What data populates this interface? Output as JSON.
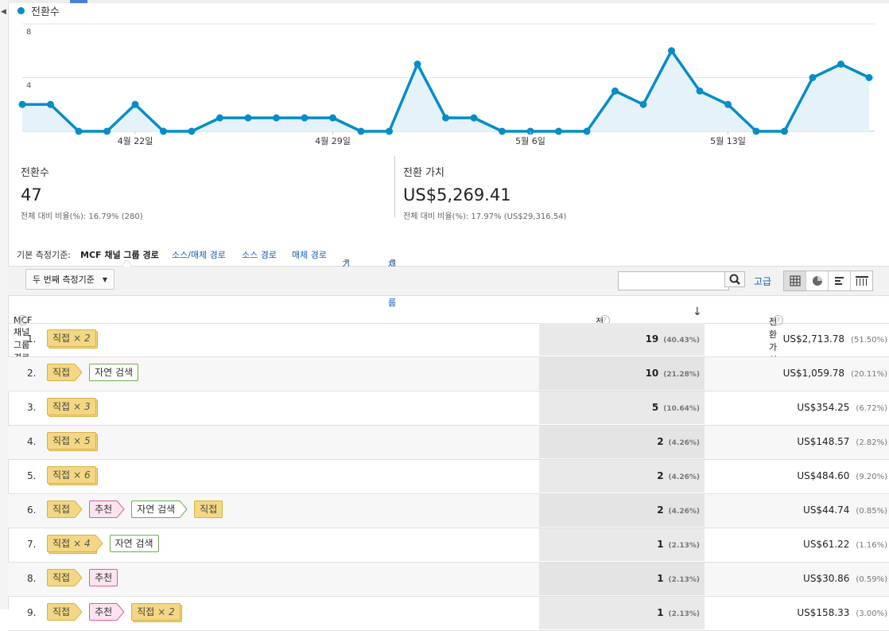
{
  "colors": {
    "accent": "#058dc7",
    "link": "#1a5fb4",
    "direct": "#f3d783",
    "organic": "#6ab04c",
    "referral": "#d9609a"
  },
  "legend": {
    "label": "전환수"
  },
  "chart_data": {
    "type": "area",
    "series": [
      {
        "name": "전환수",
        "values": [
          2,
          2,
          0,
          0,
          2,
          0,
          0,
          1,
          1,
          1,
          1,
          1,
          0,
          0,
          5,
          1,
          1,
          0,
          0,
          0,
          0,
          3,
          2,
          6,
          3,
          2,
          0,
          0,
          4,
          5,
          4
        ]
      }
    ],
    "yticks": [
      "8",
      "4"
    ],
    "ylim": [
      0,
      8
    ],
    "xticks": [
      {
        "label": "4월 22일",
        "index": 4
      },
      {
        "label": "4월 29일",
        "index": 11
      },
      {
        "label": "5월 6일",
        "index": 18
      },
      {
        "label": "5월 13일",
        "index": 25
      }
    ],
    "grid": true
  },
  "metrics": [
    {
      "label": "전환수",
      "value": "47",
      "sub": "전체 대비 비율(%): 16.79% (280)"
    },
    {
      "label": "전환 가치",
      "value": "US$5,269.41",
      "sub": "전체 대비 비율(%): 17.97% (US$29,316.54)"
    }
  ],
  "dimensions": {
    "label": "기본 측정기준:",
    "active": "MCF 채널 그룹 경로",
    "links": [
      "소스/매체 경로",
      "소스 경로",
      "매체 경로"
    ],
    "other": "기타",
    "channel": "채널 그룹"
  },
  "toolbar": {
    "secondary": "두 번째 측정기준",
    "search_value": "",
    "advanced": "고급",
    "view_icons": [
      "grid-view-icon",
      "pie-view-icon",
      "performance-view-icon",
      "pivot-view-icon"
    ]
  },
  "table": {
    "headers": {
      "path": "MCF 채널 그룹 경로",
      "conversions": "전환수",
      "value": "전환 가치"
    },
    "rows": [
      {
        "num": "1.",
        "path": [
          {
            "label": "직접",
            "type": "direct",
            "count": "× 2"
          }
        ],
        "conv": "19",
        "conv_pct": "(40.43%)",
        "value": "US$2,713.78",
        "value_pct": "(51.50%)"
      },
      {
        "num": "2.",
        "path": [
          {
            "label": "직접",
            "type": "direct"
          },
          {
            "label": "자연 검색",
            "type": "organic"
          }
        ],
        "conv": "10",
        "conv_pct": "(21.28%)",
        "value": "US$1,059.78",
        "value_pct": "(20.11%)"
      },
      {
        "num": "3.",
        "path": [
          {
            "label": "직접",
            "type": "direct",
            "count": "× 3"
          }
        ],
        "conv": "5",
        "conv_pct": "(10.64%)",
        "value": "US$354.25",
        "value_pct": "(6.72%)"
      },
      {
        "num": "4.",
        "path": [
          {
            "label": "직접",
            "type": "direct",
            "count": "× 5"
          }
        ],
        "conv": "2",
        "conv_pct": "(4.26%)",
        "value": "US$148.57",
        "value_pct": "(2.82%)"
      },
      {
        "num": "5.",
        "path": [
          {
            "label": "직접",
            "type": "direct",
            "count": "× 6"
          }
        ],
        "conv": "2",
        "conv_pct": "(4.26%)",
        "value": "US$484.60",
        "value_pct": "(9.20%)"
      },
      {
        "num": "6.",
        "path": [
          {
            "label": "직접",
            "type": "direct"
          },
          {
            "label": "추천",
            "type": "referral"
          },
          {
            "label": "자연 검색",
            "type": "organic"
          },
          {
            "label": "직접",
            "type": "direct"
          }
        ],
        "conv": "2",
        "conv_pct": "(4.26%)",
        "value": "US$44.74",
        "value_pct": "(0.85%)"
      },
      {
        "num": "7.",
        "path": [
          {
            "label": "직접",
            "type": "direct",
            "count": "× 4"
          },
          {
            "label": "자연 검색",
            "type": "organic"
          }
        ],
        "conv": "1",
        "conv_pct": "(2.13%)",
        "value": "US$61.22",
        "value_pct": "(1.16%)"
      },
      {
        "num": "8.",
        "path": [
          {
            "label": "직접",
            "type": "direct"
          },
          {
            "label": "추천",
            "type": "referral"
          }
        ],
        "conv": "1",
        "conv_pct": "(2.13%)",
        "value": "US$30.86",
        "value_pct": "(0.59%)"
      },
      {
        "num": "9.",
        "path": [
          {
            "label": "직접",
            "type": "direct"
          },
          {
            "label": "추천",
            "type": "referral"
          },
          {
            "label": "직접",
            "type": "direct",
            "count": "× 2"
          }
        ],
        "conv": "1",
        "conv_pct": "(2.13%)",
        "value": "US$158.33",
        "value_pct": "(3.00%)"
      }
    ]
  }
}
